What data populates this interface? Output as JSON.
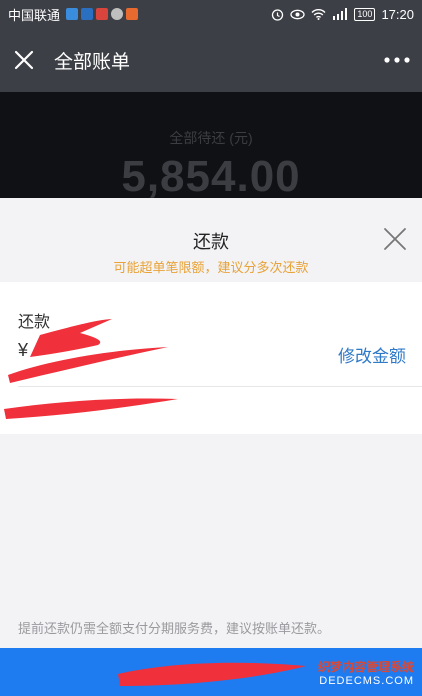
{
  "status_bar": {
    "carrier": "中国联通",
    "battery": "100",
    "time": "17:20"
  },
  "nav": {
    "title": "全部账单",
    "close_icon": "close-icon",
    "more_icon": "more-icon"
  },
  "header_behind": {
    "label": "全部待还 (元)",
    "amount": "5,854.00"
  },
  "sheet": {
    "title": "还款",
    "warning": "可能超单笔限额，建议分多次还款",
    "close_icon": "close-icon"
  },
  "repay_card": {
    "label": "还款",
    "currency": "¥",
    "edit_amount_label": "修改金额"
  },
  "note": "提前还款仍需全额支付分期服务费，建议按账单还款。",
  "watermark": {
    "line1": "织梦内容管理系统",
    "line2": "DEDECMS.COM"
  },
  "colors": {
    "nav_bg": "#3d3f46",
    "warning": "#e8a237",
    "link": "#2f79c9",
    "primary_button": "#1f7cf0",
    "redaction": "#f0303a"
  }
}
